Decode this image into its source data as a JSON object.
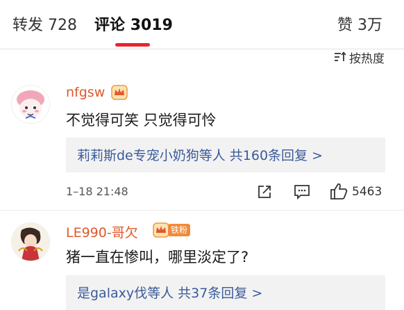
{
  "tabs": {
    "repost": {
      "label": "转发",
      "count": "728"
    },
    "comment": {
      "label": "评论",
      "count": "3019"
    },
    "like": {
      "label": "赞",
      "count": "3万"
    }
  },
  "sort": {
    "label": "按热度"
  },
  "accent_color": "#e8262d",
  "link_color": "#3b5b9a",
  "comments": [
    {
      "username": "nfgsw",
      "content": "不觉得可笑 只觉得可怜",
      "reply_summary": "莉莉斯de专宠小奶狗等人  共160条回复 >",
      "time": "1–18 21:48",
      "likes": "5463"
    },
    {
      "username": "LE990-哥欠",
      "badge": "铁粉",
      "content": "猪一直在惨叫，哪里淡定了?",
      "reply_summary": "是galaxy伐等人  共37条回复 >"
    }
  ]
}
